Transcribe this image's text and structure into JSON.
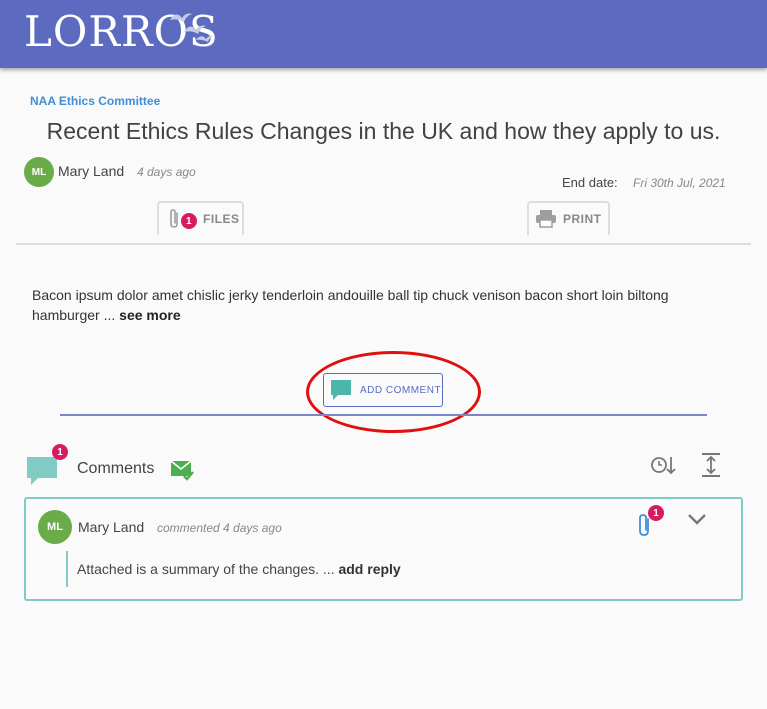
{
  "brand": {
    "logo_text": "LORROS"
  },
  "post": {
    "group": "NAA Ethics Committee",
    "title": "Recent Ethics Rules Changes in the UK and how they apply to us.",
    "author": {
      "initials": "ML",
      "name": "Mary Land",
      "time": "4 days ago"
    },
    "end_date_label": "End date:",
    "end_date_value": "Fri 30th Jul, 2021",
    "files_count": "1",
    "files_label": "FILES",
    "print_label": "PRINT",
    "body": "Bacon ipsum dolor amet chislic jerky tenderloin andouille ball tip chuck venison bacon short loin biltong hamburger ...",
    "see_more": "see more"
  },
  "add_comment_label": "ADD COMMENT",
  "comments_section": {
    "title": "Comments",
    "count": "1",
    "items": [
      {
        "initials": "ML",
        "name": "Mary Land",
        "time": "commented 4 days ago",
        "attachments": "1",
        "text": "Attached is a summary of the changes. ...",
        "reply": "add reply"
      }
    ]
  },
  "colors": {
    "header": "#5c6bc0",
    "avatar": "#6aab4a",
    "badge": "#d81b60",
    "teal": "#80cbc4",
    "link": "#3f8fd6",
    "annotation": "#e01010"
  }
}
